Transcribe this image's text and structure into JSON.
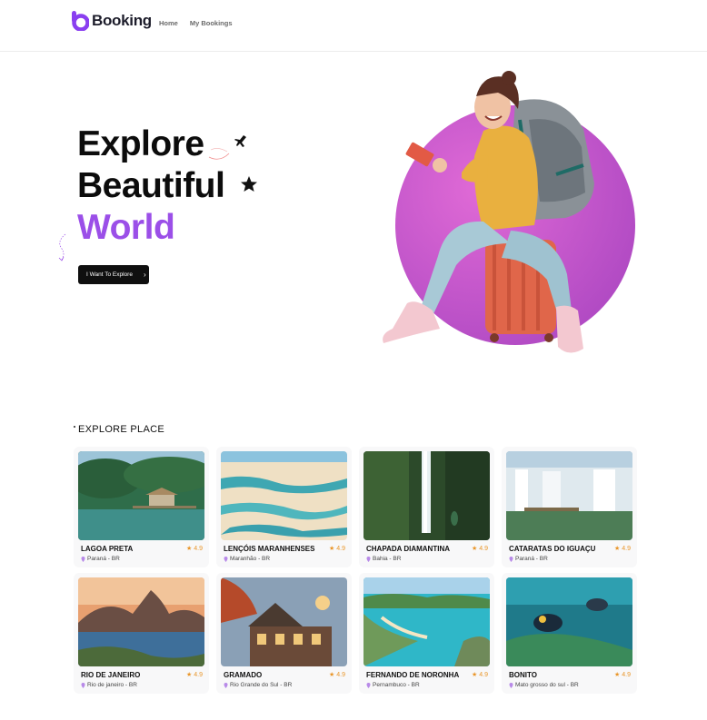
{
  "header": {
    "logo_text": "Booking",
    "nav": [
      "Home",
      "My Bookings"
    ]
  },
  "hero": {
    "line1": "Explore",
    "line2": "Beautiful",
    "line3": "World",
    "cta_label": "I Want To Explore",
    "accent_color": "#9b4fe8"
  },
  "explore": {
    "title": "EXPLORE PLACE",
    "places": [
      {
        "name": "LAGOA PRETA",
        "rating": "4.9",
        "location": "Paraná - BR"
      },
      {
        "name": "LENÇÓIS MARANHENSES",
        "rating": "4.9",
        "location": "Maranhão - BR"
      },
      {
        "name": "CHAPADA DIAMANTINA",
        "rating": "4.9",
        "location": "Bahia - BR"
      },
      {
        "name": "CATARATAS DO IGUAÇU",
        "rating": "4.9",
        "location": "Paraná - BR"
      },
      {
        "name": "RIO DE JANEIRO",
        "rating": "4.9",
        "location": "Rio de janeiro - BR"
      },
      {
        "name": "GRAMADO",
        "rating": "4.9",
        "location": "Rio Grande do Sul - BR"
      },
      {
        "name": "FERNANDO DE NORONHA",
        "rating": "4.9",
        "location": "Pernambuco - BR"
      },
      {
        "name": "BONITO",
        "rating": "4.9",
        "location": "Mato grosso do sul - BR"
      }
    ]
  }
}
